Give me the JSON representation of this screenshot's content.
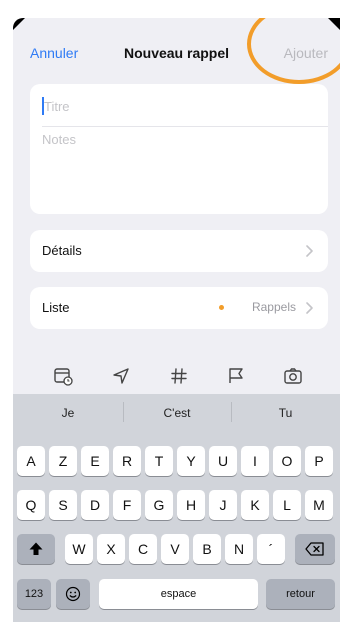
{
  "nav": {
    "cancel_label": "Annuler",
    "title": "Nouveau rappel",
    "add_label": "Ajouter"
  },
  "form": {
    "title_placeholder": "Titre",
    "notes_placeholder": "Notes"
  },
  "rows": {
    "details_label": "Détails",
    "list_label": "Liste",
    "list_value": "Rappels"
  },
  "toolbar": {
    "icons": [
      "calendar-clock-icon",
      "location-arrow-icon",
      "hashtag-icon",
      "flag-icon",
      "camera-icon"
    ]
  },
  "keyboard": {
    "suggestions": [
      "Je",
      "C'est",
      "Tu"
    ],
    "row1": [
      "A",
      "Z",
      "E",
      "R",
      "T",
      "Y",
      "U",
      "I",
      "O",
      "P"
    ],
    "row2": [
      "Q",
      "S",
      "D",
      "F",
      "G",
      "H",
      "J",
      "K",
      "L",
      "M"
    ],
    "row3": [
      "W",
      "X",
      "C",
      "V",
      "B",
      "N",
      "´"
    ],
    "numbers_label": "123",
    "space_label": "espace",
    "return_label": "retour"
  },
  "colors": {
    "accent": "#2f7bf5",
    "highlight": "#f29d2a",
    "list_dot": "#f29d2a"
  }
}
